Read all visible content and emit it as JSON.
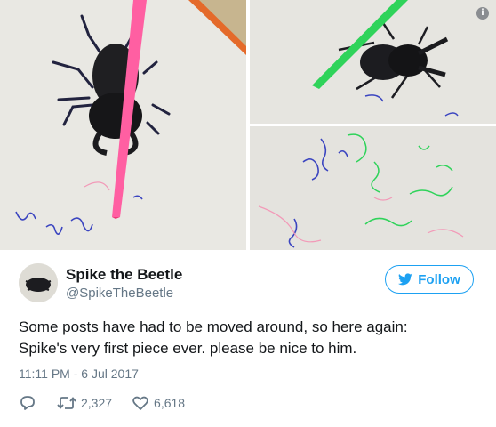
{
  "tweet": {
    "author_name": "Spike the Beetle",
    "author_handle": "@SpikeTheBeetle",
    "follow_label": "Follow",
    "text_lines": [
      "Some posts have had to be moved around, so here again:",
      "Spike's very first piece ever. please be nice to him."
    ],
    "timestamp": "11:11 PM - 6 Jul 2017",
    "retweet_count": "2,327",
    "like_count": "6,618"
  },
  "media": {
    "info_glyph": "i",
    "photos": [
      "beetle-with-pink-marker",
      "beetle-with-green-marker",
      "marker-scribbles-on-paper"
    ]
  },
  "colors": {
    "accent": "#1da1f2",
    "secondary_text": "#657786",
    "primary_text": "#14171a",
    "pink_marker": "#ff5fa2",
    "green_marker": "#2fd35a"
  },
  "icons": [
    "info-icon",
    "bird-icon",
    "reply-icon",
    "retweet-icon",
    "heart-icon"
  ]
}
